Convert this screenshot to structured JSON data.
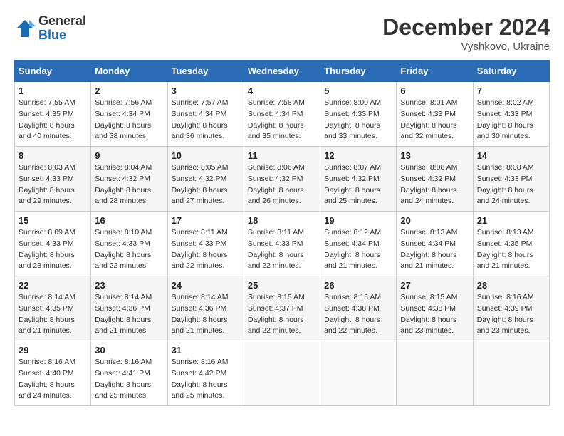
{
  "header": {
    "logo_line1": "General",
    "logo_line2": "Blue",
    "month": "December 2024",
    "location": "Vyshkovo, Ukraine"
  },
  "columns": [
    "Sunday",
    "Monday",
    "Tuesday",
    "Wednesday",
    "Thursday",
    "Friday",
    "Saturday"
  ],
  "weeks": [
    [
      {
        "day": "1",
        "sunrise": "7:55 AM",
        "sunset": "4:35 PM",
        "daylight": "8 hours and 40 minutes."
      },
      {
        "day": "2",
        "sunrise": "7:56 AM",
        "sunset": "4:34 PM",
        "daylight": "8 hours and 38 minutes."
      },
      {
        "day": "3",
        "sunrise": "7:57 AM",
        "sunset": "4:34 PM",
        "daylight": "8 hours and 36 minutes."
      },
      {
        "day": "4",
        "sunrise": "7:58 AM",
        "sunset": "4:34 PM",
        "daylight": "8 hours and 35 minutes."
      },
      {
        "day": "5",
        "sunrise": "8:00 AM",
        "sunset": "4:33 PM",
        "daylight": "8 hours and 33 minutes."
      },
      {
        "day": "6",
        "sunrise": "8:01 AM",
        "sunset": "4:33 PM",
        "daylight": "8 hours and 32 minutes."
      },
      {
        "day": "7",
        "sunrise": "8:02 AM",
        "sunset": "4:33 PM",
        "daylight": "8 hours and 30 minutes."
      }
    ],
    [
      {
        "day": "8",
        "sunrise": "8:03 AM",
        "sunset": "4:33 PM",
        "daylight": "8 hours and 29 minutes."
      },
      {
        "day": "9",
        "sunrise": "8:04 AM",
        "sunset": "4:32 PM",
        "daylight": "8 hours and 28 minutes."
      },
      {
        "day": "10",
        "sunrise": "8:05 AM",
        "sunset": "4:32 PM",
        "daylight": "8 hours and 27 minutes."
      },
      {
        "day": "11",
        "sunrise": "8:06 AM",
        "sunset": "4:32 PM",
        "daylight": "8 hours and 26 minutes."
      },
      {
        "day": "12",
        "sunrise": "8:07 AM",
        "sunset": "4:32 PM",
        "daylight": "8 hours and 25 minutes."
      },
      {
        "day": "13",
        "sunrise": "8:08 AM",
        "sunset": "4:32 PM",
        "daylight": "8 hours and 24 minutes."
      },
      {
        "day": "14",
        "sunrise": "8:08 AM",
        "sunset": "4:33 PM",
        "daylight": "8 hours and 24 minutes."
      }
    ],
    [
      {
        "day": "15",
        "sunrise": "8:09 AM",
        "sunset": "4:33 PM",
        "daylight": "8 hours and 23 minutes."
      },
      {
        "day": "16",
        "sunrise": "8:10 AM",
        "sunset": "4:33 PM",
        "daylight": "8 hours and 22 minutes."
      },
      {
        "day": "17",
        "sunrise": "8:11 AM",
        "sunset": "4:33 PM",
        "daylight": "8 hours and 22 minutes."
      },
      {
        "day": "18",
        "sunrise": "8:11 AM",
        "sunset": "4:33 PM",
        "daylight": "8 hours and 22 minutes."
      },
      {
        "day": "19",
        "sunrise": "8:12 AM",
        "sunset": "4:34 PM",
        "daylight": "8 hours and 21 minutes."
      },
      {
        "day": "20",
        "sunrise": "8:13 AM",
        "sunset": "4:34 PM",
        "daylight": "8 hours and 21 minutes."
      },
      {
        "day": "21",
        "sunrise": "8:13 AM",
        "sunset": "4:35 PM",
        "daylight": "8 hours and 21 minutes."
      }
    ],
    [
      {
        "day": "22",
        "sunrise": "8:14 AM",
        "sunset": "4:35 PM",
        "daylight": "8 hours and 21 minutes."
      },
      {
        "day": "23",
        "sunrise": "8:14 AM",
        "sunset": "4:36 PM",
        "daylight": "8 hours and 21 minutes."
      },
      {
        "day": "24",
        "sunrise": "8:14 AM",
        "sunset": "4:36 PM",
        "daylight": "8 hours and 21 minutes."
      },
      {
        "day": "25",
        "sunrise": "8:15 AM",
        "sunset": "4:37 PM",
        "daylight": "8 hours and 22 minutes."
      },
      {
        "day": "26",
        "sunrise": "8:15 AM",
        "sunset": "4:38 PM",
        "daylight": "8 hours and 22 minutes."
      },
      {
        "day": "27",
        "sunrise": "8:15 AM",
        "sunset": "4:38 PM",
        "daylight": "8 hours and 23 minutes."
      },
      {
        "day": "28",
        "sunrise": "8:16 AM",
        "sunset": "4:39 PM",
        "daylight": "8 hours and 23 minutes."
      }
    ],
    [
      {
        "day": "29",
        "sunrise": "8:16 AM",
        "sunset": "4:40 PM",
        "daylight": "8 hours and 24 minutes."
      },
      {
        "day": "30",
        "sunrise": "8:16 AM",
        "sunset": "4:41 PM",
        "daylight": "8 hours and 25 minutes."
      },
      {
        "day": "31",
        "sunrise": "8:16 AM",
        "sunset": "4:42 PM",
        "daylight": "8 hours and 25 minutes."
      },
      null,
      null,
      null,
      null
    ]
  ]
}
